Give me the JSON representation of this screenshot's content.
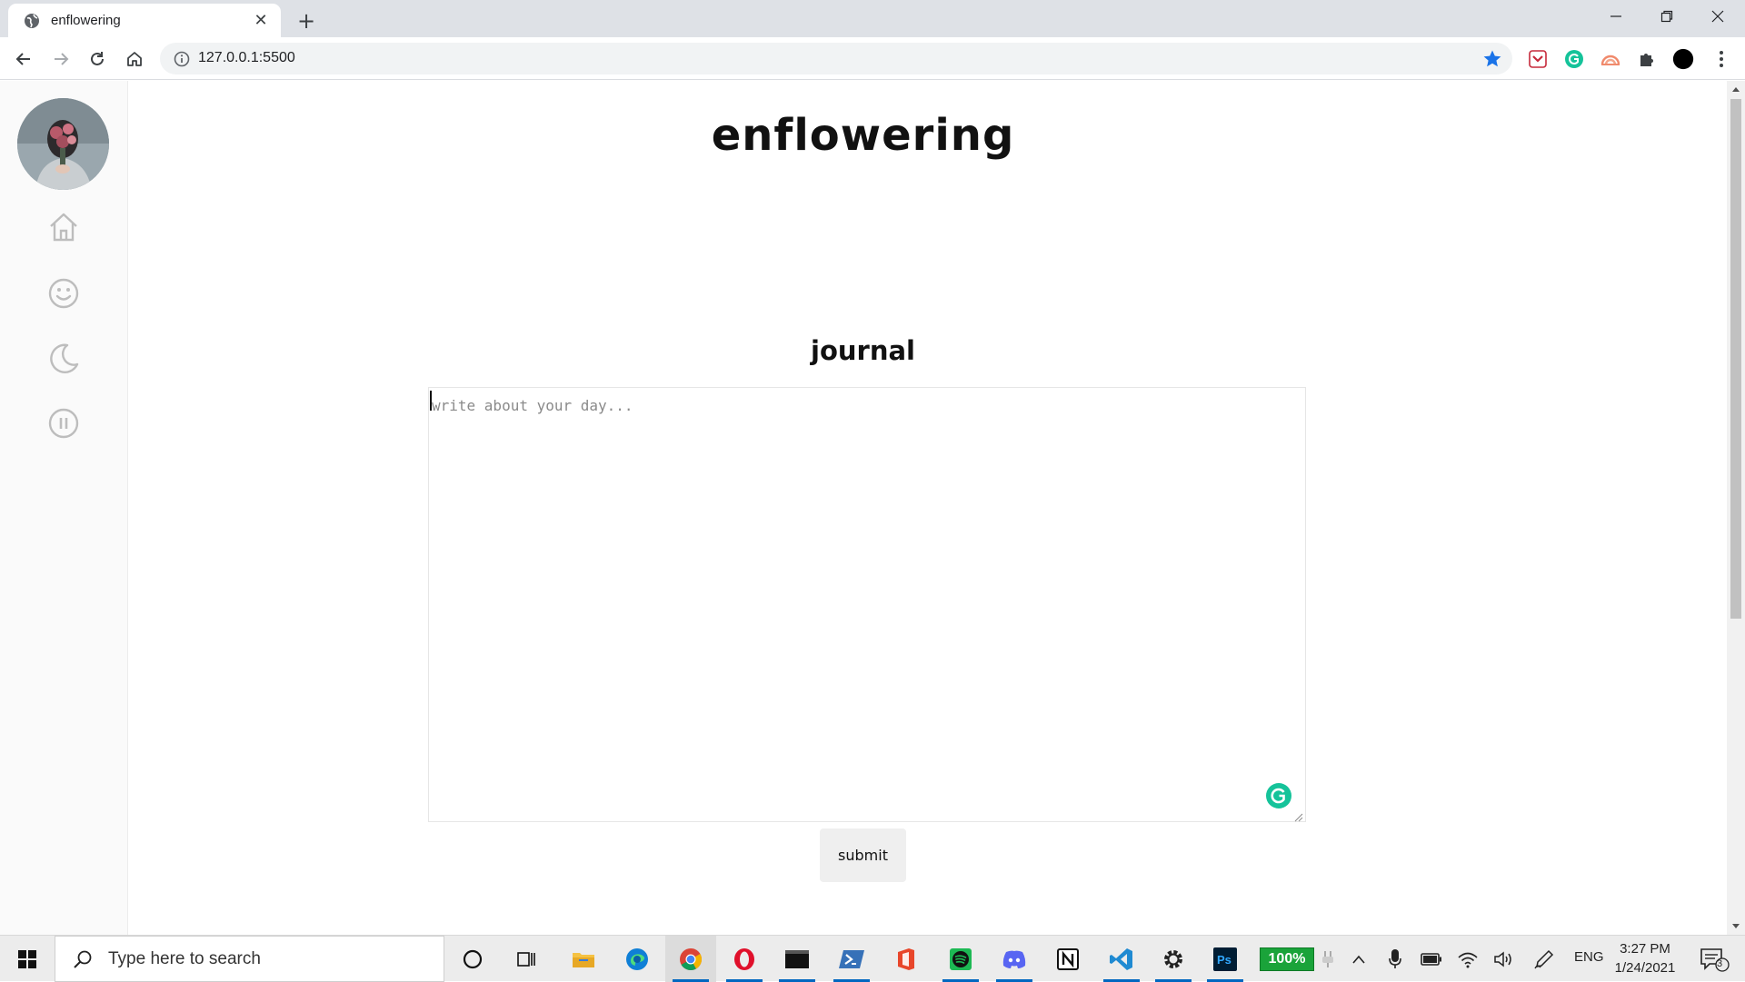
{
  "browser": {
    "tab_title": "enflowering",
    "url": "127.0.0.1:5500",
    "new_tab_symbol": "+",
    "close_symbol": "✕"
  },
  "page": {
    "brand": "enflowering",
    "section_title": "journal",
    "journal_placeholder": "write about your day...",
    "submit_label": "submit"
  },
  "sidebar": {
    "items": [
      {
        "icon": "home-icon"
      },
      {
        "icon": "smiley-icon"
      },
      {
        "icon": "moon-icon"
      },
      {
        "icon": "pause-icon"
      }
    ]
  },
  "taskbar": {
    "search_placeholder": "Type here to search",
    "battery_widget": "100%",
    "language": "ENG",
    "time": "3:27 PM",
    "date": "1/24/2021",
    "notification_count": "3"
  },
  "colors": {
    "bookmark_star": "#1a73e8",
    "grammarly": "#15c39a",
    "battery_widget": "#1aa33a",
    "taskbar_underline": "#0067c0"
  }
}
